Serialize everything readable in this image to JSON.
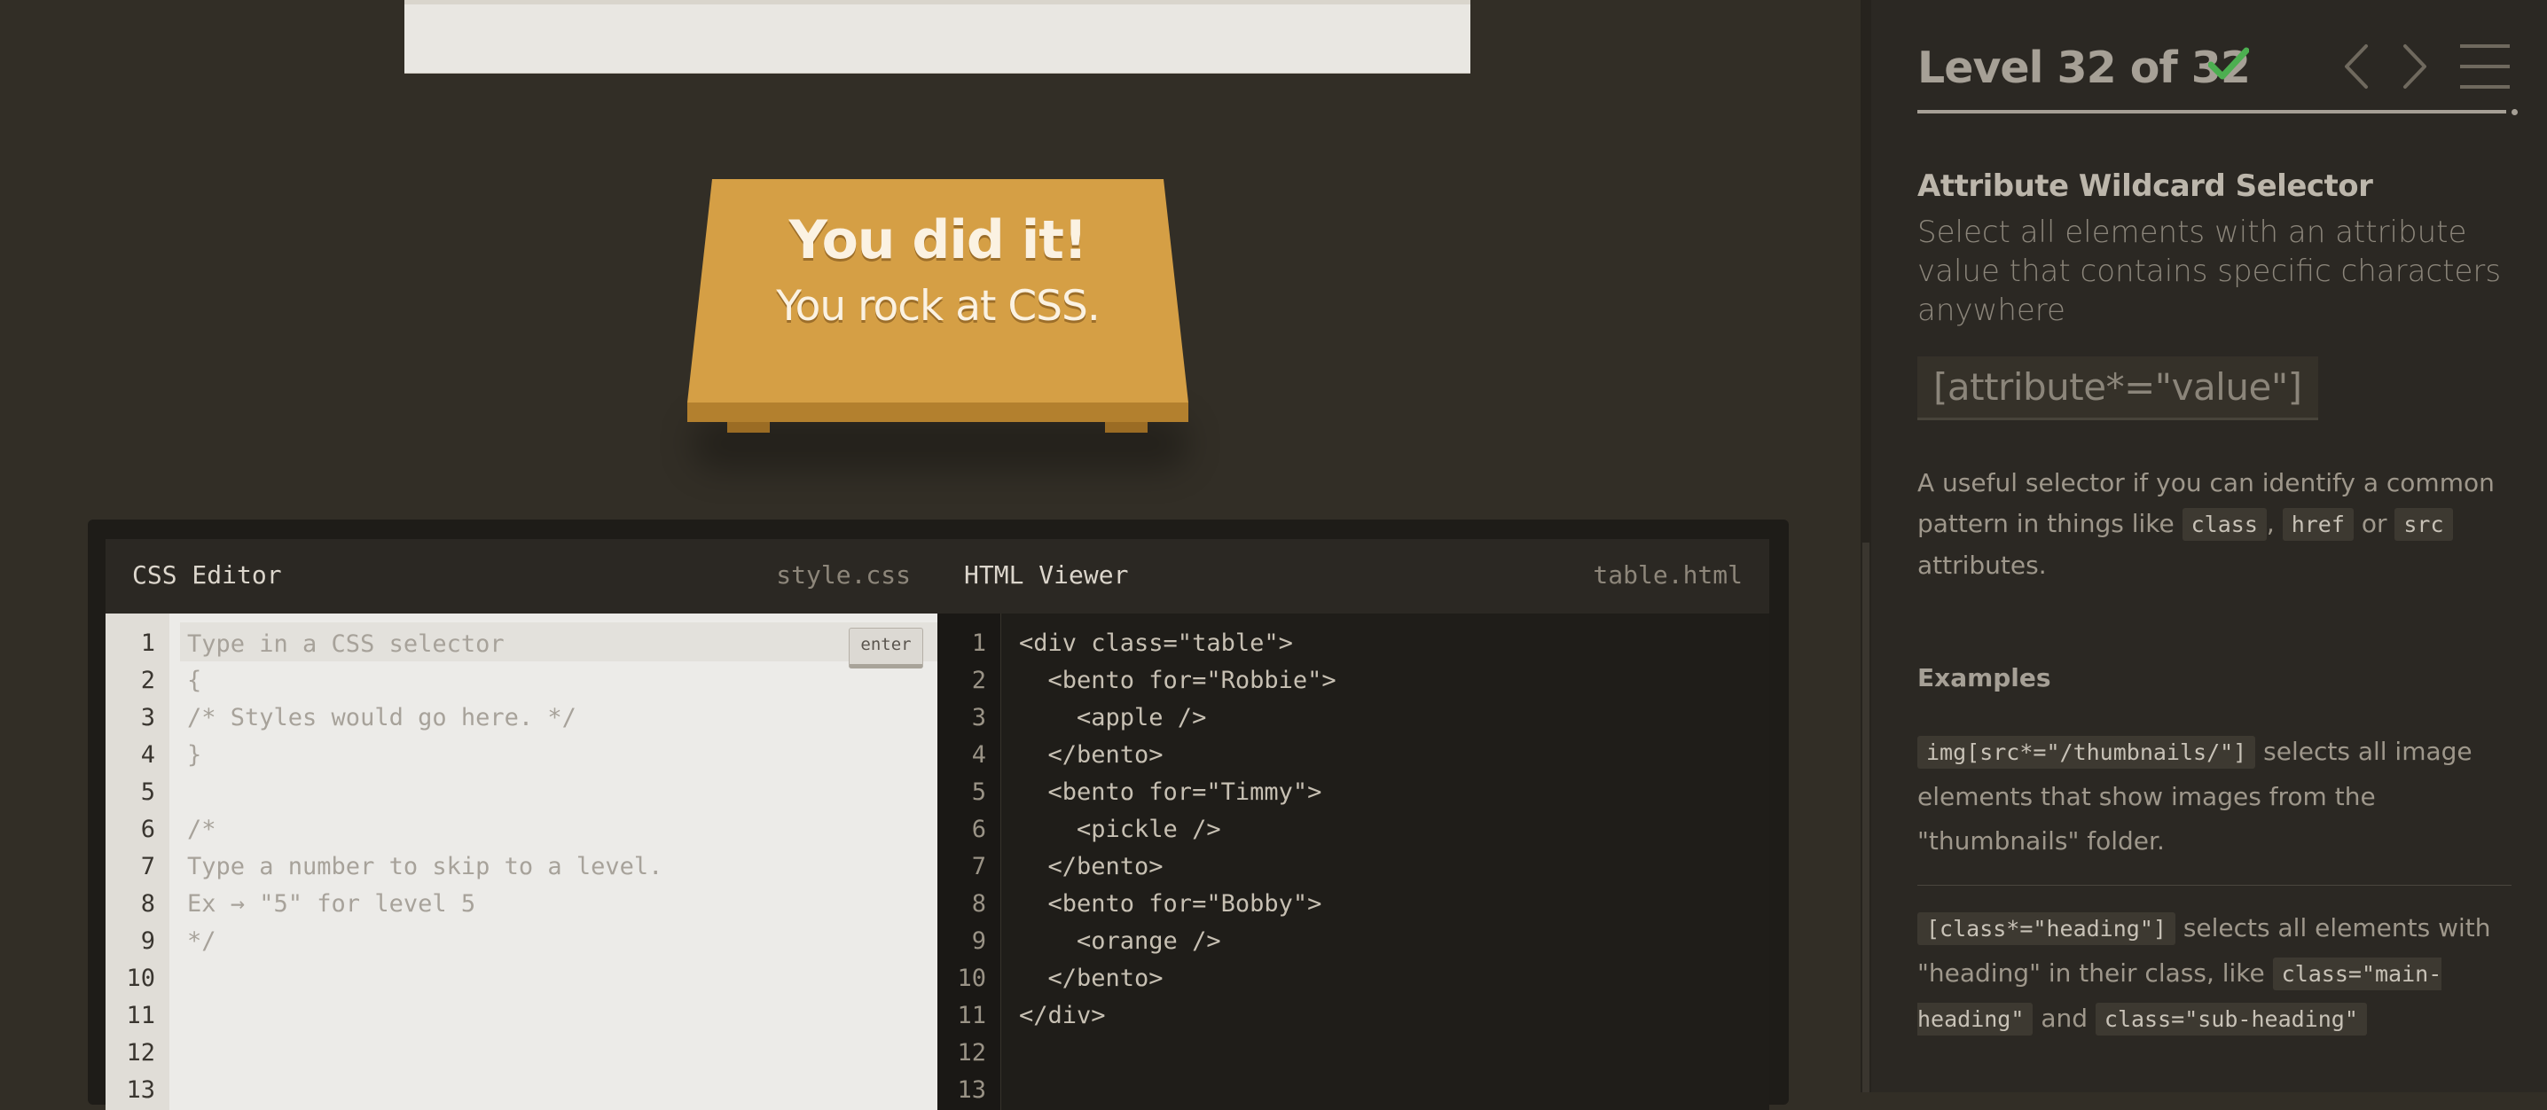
{
  "win": {
    "title": "You did it!",
    "subtitle": "You rock at CSS."
  },
  "css_editor": {
    "title": "CSS Editor",
    "file": "style.css",
    "input_placeholder": "Type in a CSS selector",
    "enter_label": "enter",
    "line_numbers": [
      "1",
      "2",
      "3",
      "4",
      "5",
      "6",
      "7",
      "8",
      "9",
      "10",
      "11",
      "12",
      "13"
    ],
    "lines": [
      "",
      "{",
      "/* Styles would go here. */",
      "}",
      "",
      "/*",
      "Type a number to skip to a level.",
      "Ex → \"5\" for level 5",
      "*/",
      "",
      "",
      "",
      ""
    ]
  },
  "html_viewer": {
    "title": "HTML Viewer",
    "file": "table.html",
    "line_numbers": [
      "1",
      "2",
      "3",
      "4",
      "5",
      "6",
      "7",
      "8",
      "9",
      "10",
      "11",
      "12",
      "13"
    ],
    "lines": [
      "<div class=\"table\">",
      "  <bento for=\"Robbie\">",
      "    <apple />",
      "  </bento>",
      "  <bento for=\"Timmy\">",
      "    <pickle />",
      "  </bento>",
      "  <bento for=\"Bobby\">",
      "    <orange />",
      "  </bento>",
      "</div>",
      "",
      ""
    ]
  },
  "sidebar": {
    "level_title": "Level 32 of 32",
    "level_completed": true,
    "progress_fraction": 1.0,
    "selector_name": "Attribute Wildcard Selector",
    "selector_description": "Select all elements with an attribute value that contains specific characters anywhere",
    "syntax": "[attribute*=\"value\"]",
    "hint": {
      "part1": "A useful selector if you can identify a common pattern in things like ",
      "code1": "class",
      "sep1": ",",
      "code2": "href",
      "sep2": " or ",
      "code3": "src",
      "part2": " attributes."
    },
    "examples_title": "Examples",
    "examples": [
      {
        "code": "img[src*=\"/thumbnails/\"]",
        "text": " selects all image elements that show images from the \"thumbnails\" folder."
      },
      {
        "code": "[class*=\"heading\"]",
        "text1": " selects all elements with \"heading\" in their class, like ",
        "code2": "class=\"main-heading\"",
        "text2": " and ",
        "code3": "class=\"sub-heading\""
      }
    ]
  },
  "colors": {
    "background": "#322e26",
    "table": "#d59f45",
    "check": "#4caf50",
    "sidebar": "#2b2823"
  },
  "icons": [
    "check-icon",
    "chevron-left-icon",
    "chevron-right-icon",
    "menu-icon"
  ]
}
